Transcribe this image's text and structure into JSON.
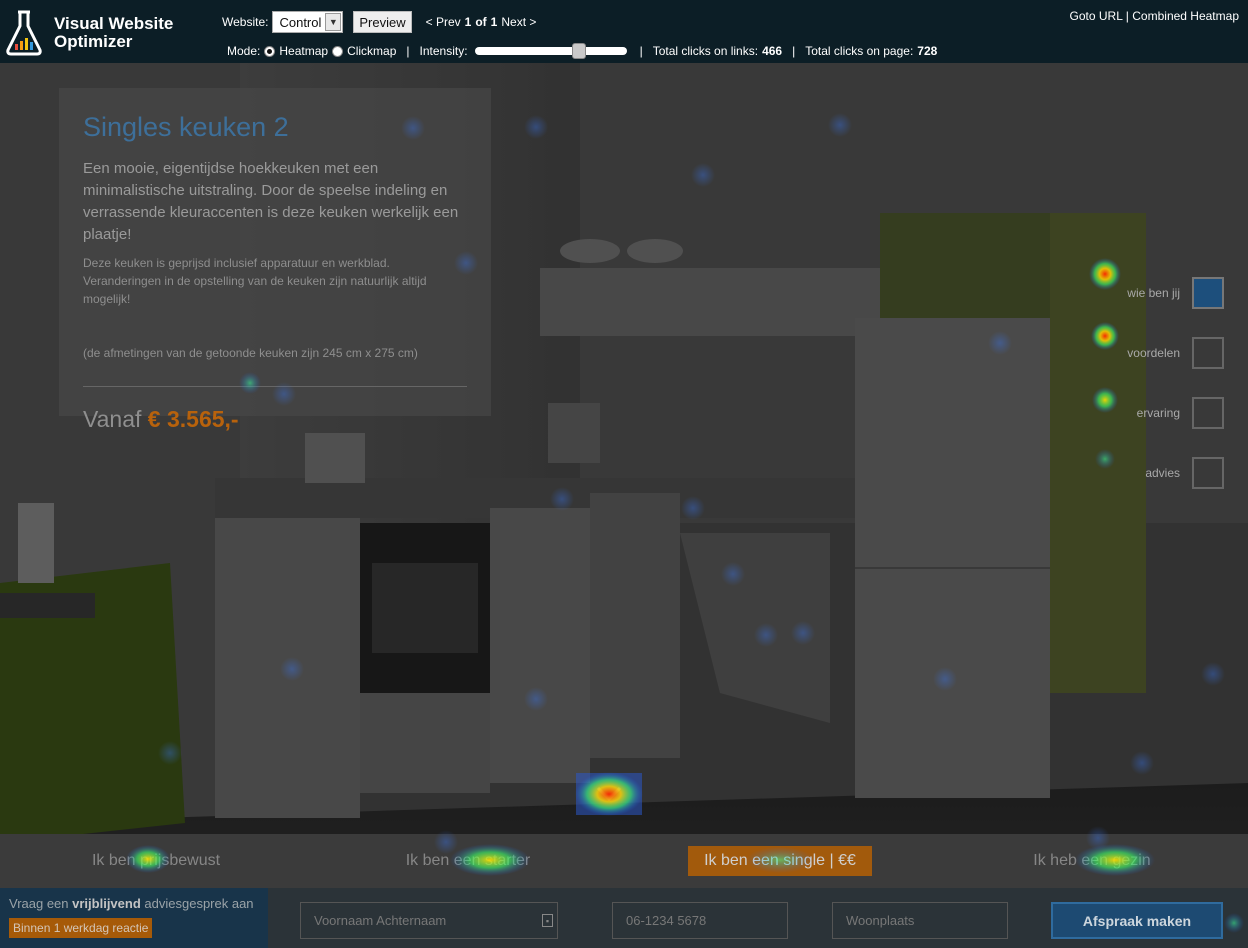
{
  "toolbar": {
    "brand_line1": "Visual Website",
    "brand_line2": "Optimizer",
    "website_label": "Website:",
    "website_value": "Control",
    "preview_label": "Preview",
    "prev_label": "< Prev",
    "page_current": "1",
    "of_label": "of",
    "page_total": "1",
    "next_label": "Next >",
    "goto_url": "Goto URL",
    "divider": "|",
    "combined_heatmap": "Combined Heatmap",
    "mode_label": "Mode:",
    "mode_heatmap": "Heatmap",
    "mode_clickmap": "Clickmap",
    "selected_mode": "Heatmap",
    "intensity_label": "Intensity:",
    "intensity_level": 0.7,
    "links_label": "Total clicks on links:",
    "links_value": "466",
    "page_label": "Total clicks on page:",
    "page_value": "728"
  },
  "page": {
    "title": "Singles keuken 2",
    "lead": "Een mooie, eigentijdse hoekkeuken met een minimalistische uitstraling. Door de speelse indeling en verrassende kleuraccenten is deze keuken werkelijk een plaatje!",
    "details": "Deze keuken is geprijsd inclusief apparatuur en werkblad. Veranderingen in de opstelling van de keuken zijn natuurlijk altijd mogelijk!",
    "dimensions": "(de afmetingen van de getoonde keuken zijn 245 cm x 275 cm)",
    "price_prefix": "Vanaf",
    "price": "€ 3.565,-",
    "side_nav": [
      {
        "label": "wie ben jij",
        "active": true
      },
      {
        "label": "voordelen",
        "active": false
      },
      {
        "label": "ervaring",
        "active": false
      },
      {
        "label": "advies",
        "active": false
      }
    ],
    "personas": [
      {
        "label": "Ik ben prijsbewust"
      },
      {
        "label": "Ik ben een starter"
      },
      {
        "label": "Ik ben een single  |  €€",
        "highlight": true
      },
      {
        "label": "Ik heb een gezin"
      }
    ],
    "footer": {
      "text_pre": "Vraag een",
      "text_bold": "vrijblijvend",
      "text_post": "adviesgesprek aan",
      "badge": "Binnen 1 werkdag reactie",
      "name_placeholder": "Voornaam Achternaam",
      "phone_placeholder": "06-1234 5678",
      "city_placeholder": "Woonplaats",
      "submit": "Afspraak maken"
    }
  },
  "colors": {
    "toolbar_bg": "#0c1e26",
    "accent_blue": "#1d4f7c",
    "accent_orange": "#b8620c"
  }
}
